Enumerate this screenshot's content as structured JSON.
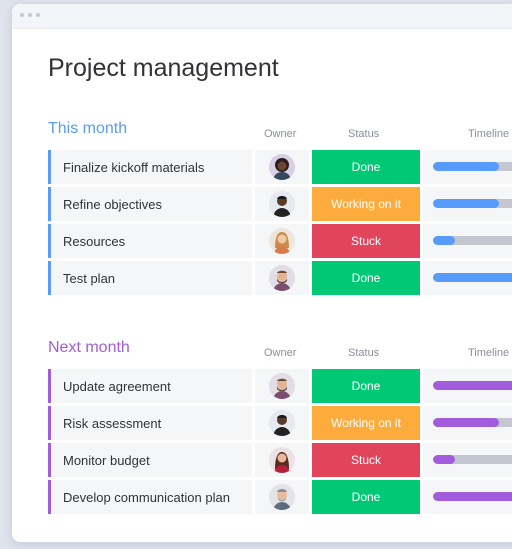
{
  "app": {
    "title": "Project management"
  },
  "columns": {
    "owner": "Owner",
    "status": "Status",
    "timeline": "Timeline"
  },
  "colors": {
    "done": "#00c875",
    "working": "#fdab3d",
    "stuck": "#e2445c",
    "this_month_accent": "#579bfc",
    "next_month_accent": "#a25ddc",
    "timeline_track": "#c5c7d0"
  },
  "groups": [
    {
      "title": "This month",
      "color": "#579bfc",
      "rows": [
        {
          "task": "Finalize kickoff materials",
          "owner_icon": "avatar-woman-curly-hair",
          "status": "Done",
          "status_key": "done",
          "progress": 0.6
        },
        {
          "task": "Refine objectives",
          "owner_icon": "avatar-man-dark-skin",
          "status": "Working on it",
          "status_key": "working",
          "progress": 0.6
        },
        {
          "task": "Resources",
          "owner_icon": "avatar-woman-blonde",
          "status": "Stuck",
          "status_key": "stuck",
          "progress": 0.2
        },
        {
          "task": "Test plan",
          "owner_icon": "avatar-man-beard",
          "status": "Done",
          "status_key": "done",
          "progress": 1.0
        }
      ]
    },
    {
      "title": "Next month",
      "color": "#a25ddc",
      "rows": [
        {
          "task": "Update agreement",
          "owner_icon": "avatar-man-beard",
          "status": "Done",
          "status_key": "done",
          "progress": 1.0
        },
        {
          "task": "Risk assessment",
          "owner_icon": "avatar-man-dark-skin",
          "status": "Working on it",
          "status_key": "working",
          "progress": 0.6
        },
        {
          "task": "Monitor budget",
          "owner_icon": "avatar-woman-dark-hair",
          "status": "Stuck",
          "status_key": "stuck",
          "progress": 0.2
        },
        {
          "task": "Develop communication plan",
          "owner_icon": "avatar-man-gray-hair",
          "status": "Done",
          "status_key": "done",
          "progress": 1.0
        }
      ]
    }
  ]
}
